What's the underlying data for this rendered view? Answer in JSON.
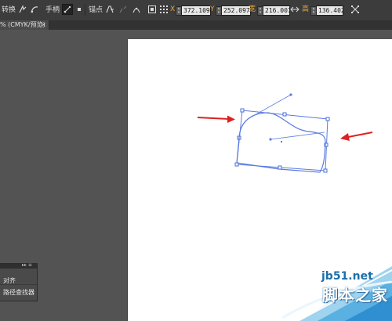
{
  "control_bar": {
    "convert_label": "转换",
    "handles_label": "手柄",
    "anchor_label": "锚点",
    "x_label": "X",
    "x_value": "372.109",
    "y_label": "Y",
    "y_value": "252.097",
    "width_label": "宽",
    "width_value": "216.007",
    "height_label": "高",
    "height_value": "136.402"
  },
  "document_tab": {
    "title": "% (CMYK/预览)",
    "close_glyph": "×"
  },
  "panel": {
    "header_controls": "▸▸ ≡",
    "items": [
      {
        "label": "对齐"
      },
      {
        "label": "路径查找器"
      }
    ]
  },
  "watermark": {
    "url": "jb51.net",
    "name": "脚本之家"
  },
  "colors": {
    "workspace": "#535353",
    "artboard": "#ffffff",
    "selection_blue": "#4a6fd8",
    "arrow_red": "#e02020",
    "field_label_orange": "#e8a33a"
  },
  "icons": [
    "convert-anchor-corner-icon",
    "convert-anchor-smooth-icon",
    "show-handles-icon",
    "hide-handles-icon",
    "remove-anchor-icon",
    "connect-anchor-icon",
    "cut-path-icon",
    "isolate-icon",
    "reference-point-icon",
    "constrain-proportions-icon",
    "transform-icon"
  ]
}
